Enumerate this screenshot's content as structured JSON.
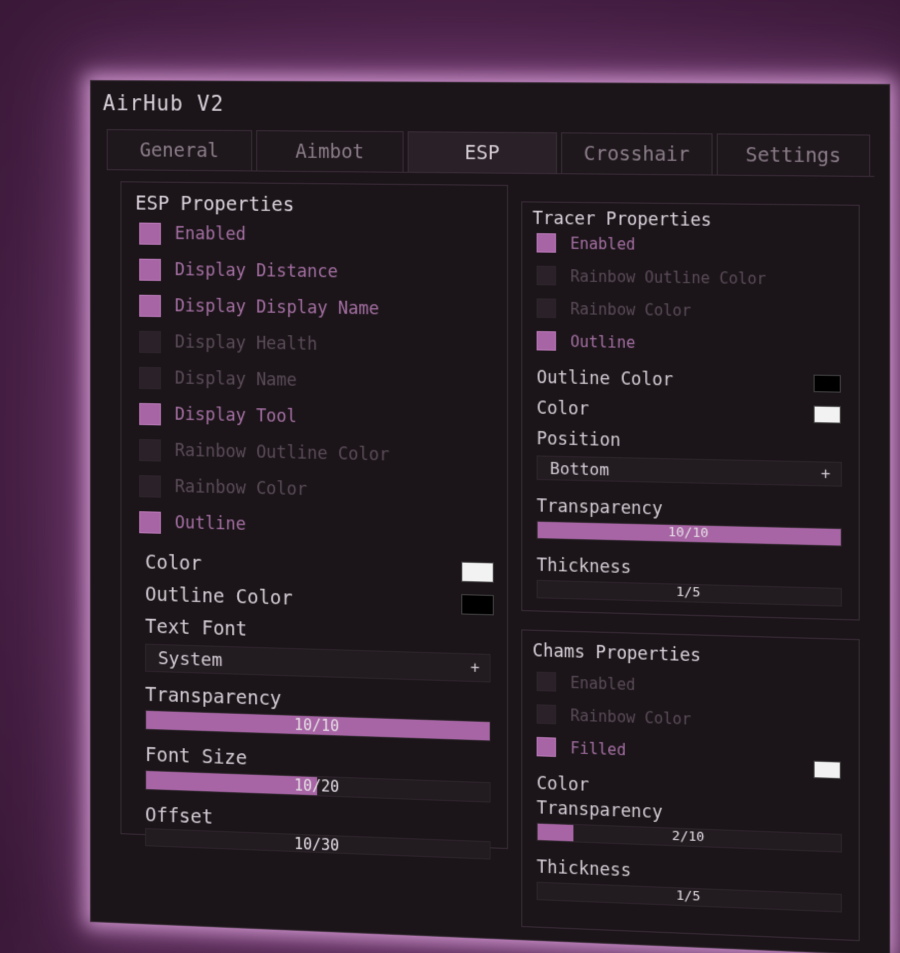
{
  "window": {
    "title": "AirHub V2"
  },
  "tabs": [
    "General",
    "Aimbot",
    "ESP",
    "Crosshair",
    "Settings"
  ],
  "active_tab": "ESP",
  "colors": {
    "accent": "#a765a5",
    "white_swatch": "#f2f2f2",
    "black_swatch": "#000000"
  },
  "esp": {
    "title": "ESP Properties",
    "checks": [
      {
        "label": "Enabled",
        "on": true
      },
      {
        "label": "Display Distance",
        "on": true
      },
      {
        "label": "Display Display Name",
        "on": true
      },
      {
        "label": "Display Health",
        "on": false
      },
      {
        "label": "Display Name",
        "on": false
      },
      {
        "label": "Display Tool",
        "on": true
      },
      {
        "label": "Rainbow Outline Color",
        "on": false
      },
      {
        "label": "Rainbow Color",
        "on": false
      },
      {
        "label": "Outline",
        "on": true
      }
    ],
    "color_label": "Color",
    "outline_color_label": "Outline Color",
    "text_font_label": "Text Font",
    "text_font_value": "System",
    "transparency_label": "Transparency",
    "transparency_value": "10/10",
    "transparency_fraction": 1.0,
    "font_size_label": "Font Size",
    "font_size_value": "10/20",
    "font_size_fraction": 0.5,
    "offset_label": "Offset",
    "offset_value": "10/30",
    "offset_fraction": 0.0
  },
  "tracer": {
    "title": "Tracer Properties",
    "checks": [
      {
        "label": "Enabled",
        "on": true
      },
      {
        "label": "Rainbow Outline Color",
        "on": false
      },
      {
        "label": "Rainbow Color",
        "on": false
      },
      {
        "label": "Outline",
        "on": true
      }
    ],
    "outline_color_label": "Outline Color",
    "color_label": "Color",
    "position_label": "Position",
    "position_value": "Bottom",
    "transparency_label": "Transparency",
    "transparency_value": "10/10",
    "transparency_fraction": 1.0,
    "thickness_label": "Thickness",
    "thickness_value": "1/5",
    "thickness_fraction": 0.0
  },
  "chams": {
    "title": "Chams Properties",
    "checks": [
      {
        "label": "Enabled",
        "on": false
      },
      {
        "label": "Rainbow Color",
        "on": false
      },
      {
        "label": "Filled",
        "on": true
      }
    ],
    "color_label": "Color",
    "transparency_label": "Transparency",
    "transparency_value": "2/10",
    "transparency_fraction": 0.12,
    "thickness_label": "Thickness",
    "thickness_value": "1/5",
    "thickness_fraction": 0.0
  }
}
